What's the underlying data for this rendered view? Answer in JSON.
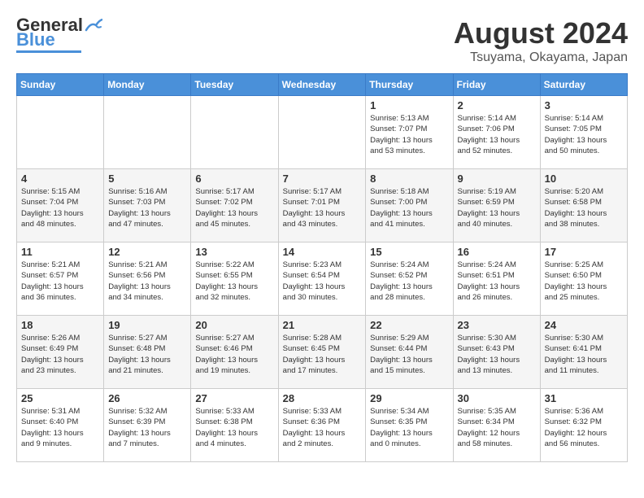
{
  "logo": {
    "text_general": "General",
    "text_blue": "Blue"
  },
  "header": {
    "month": "August 2024",
    "location": "Tsuyama, Okayama, Japan"
  },
  "weekdays": [
    "Sunday",
    "Monday",
    "Tuesday",
    "Wednesday",
    "Thursday",
    "Friday",
    "Saturday"
  ],
  "weeks": [
    [
      {
        "day": "",
        "info": ""
      },
      {
        "day": "",
        "info": ""
      },
      {
        "day": "",
        "info": ""
      },
      {
        "day": "",
        "info": ""
      },
      {
        "day": "1",
        "info": "Sunrise: 5:13 AM\nSunset: 7:07 PM\nDaylight: 13 hours\nand 53 minutes."
      },
      {
        "day": "2",
        "info": "Sunrise: 5:14 AM\nSunset: 7:06 PM\nDaylight: 13 hours\nand 52 minutes."
      },
      {
        "day": "3",
        "info": "Sunrise: 5:14 AM\nSunset: 7:05 PM\nDaylight: 13 hours\nand 50 minutes."
      }
    ],
    [
      {
        "day": "4",
        "info": "Sunrise: 5:15 AM\nSunset: 7:04 PM\nDaylight: 13 hours\nand 48 minutes."
      },
      {
        "day": "5",
        "info": "Sunrise: 5:16 AM\nSunset: 7:03 PM\nDaylight: 13 hours\nand 47 minutes."
      },
      {
        "day": "6",
        "info": "Sunrise: 5:17 AM\nSunset: 7:02 PM\nDaylight: 13 hours\nand 45 minutes."
      },
      {
        "day": "7",
        "info": "Sunrise: 5:17 AM\nSunset: 7:01 PM\nDaylight: 13 hours\nand 43 minutes."
      },
      {
        "day": "8",
        "info": "Sunrise: 5:18 AM\nSunset: 7:00 PM\nDaylight: 13 hours\nand 41 minutes."
      },
      {
        "day": "9",
        "info": "Sunrise: 5:19 AM\nSunset: 6:59 PM\nDaylight: 13 hours\nand 40 minutes."
      },
      {
        "day": "10",
        "info": "Sunrise: 5:20 AM\nSunset: 6:58 PM\nDaylight: 13 hours\nand 38 minutes."
      }
    ],
    [
      {
        "day": "11",
        "info": "Sunrise: 5:21 AM\nSunset: 6:57 PM\nDaylight: 13 hours\nand 36 minutes."
      },
      {
        "day": "12",
        "info": "Sunrise: 5:21 AM\nSunset: 6:56 PM\nDaylight: 13 hours\nand 34 minutes."
      },
      {
        "day": "13",
        "info": "Sunrise: 5:22 AM\nSunset: 6:55 PM\nDaylight: 13 hours\nand 32 minutes."
      },
      {
        "day": "14",
        "info": "Sunrise: 5:23 AM\nSunset: 6:54 PM\nDaylight: 13 hours\nand 30 minutes."
      },
      {
        "day": "15",
        "info": "Sunrise: 5:24 AM\nSunset: 6:52 PM\nDaylight: 13 hours\nand 28 minutes."
      },
      {
        "day": "16",
        "info": "Sunrise: 5:24 AM\nSunset: 6:51 PM\nDaylight: 13 hours\nand 26 minutes."
      },
      {
        "day": "17",
        "info": "Sunrise: 5:25 AM\nSunset: 6:50 PM\nDaylight: 13 hours\nand 25 minutes."
      }
    ],
    [
      {
        "day": "18",
        "info": "Sunrise: 5:26 AM\nSunset: 6:49 PM\nDaylight: 13 hours\nand 23 minutes."
      },
      {
        "day": "19",
        "info": "Sunrise: 5:27 AM\nSunset: 6:48 PM\nDaylight: 13 hours\nand 21 minutes."
      },
      {
        "day": "20",
        "info": "Sunrise: 5:27 AM\nSunset: 6:46 PM\nDaylight: 13 hours\nand 19 minutes."
      },
      {
        "day": "21",
        "info": "Sunrise: 5:28 AM\nSunset: 6:45 PM\nDaylight: 13 hours\nand 17 minutes."
      },
      {
        "day": "22",
        "info": "Sunrise: 5:29 AM\nSunset: 6:44 PM\nDaylight: 13 hours\nand 15 minutes."
      },
      {
        "day": "23",
        "info": "Sunrise: 5:30 AM\nSunset: 6:43 PM\nDaylight: 13 hours\nand 13 minutes."
      },
      {
        "day": "24",
        "info": "Sunrise: 5:30 AM\nSunset: 6:41 PM\nDaylight: 13 hours\nand 11 minutes."
      }
    ],
    [
      {
        "day": "25",
        "info": "Sunrise: 5:31 AM\nSunset: 6:40 PM\nDaylight: 13 hours\nand 9 minutes."
      },
      {
        "day": "26",
        "info": "Sunrise: 5:32 AM\nSunset: 6:39 PM\nDaylight: 13 hours\nand 7 minutes."
      },
      {
        "day": "27",
        "info": "Sunrise: 5:33 AM\nSunset: 6:38 PM\nDaylight: 13 hours\nand 4 minutes."
      },
      {
        "day": "28",
        "info": "Sunrise: 5:33 AM\nSunset: 6:36 PM\nDaylight: 13 hours\nand 2 minutes."
      },
      {
        "day": "29",
        "info": "Sunrise: 5:34 AM\nSunset: 6:35 PM\nDaylight: 13 hours\nand 0 minutes."
      },
      {
        "day": "30",
        "info": "Sunrise: 5:35 AM\nSunset: 6:34 PM\nDaylight: 12 hours\nand 58 minutes."
      },
      {
        "day": "31",
        "info": "Sunrise: 5:36 AM\nSunset: 6:32 PM\nDaylight: 12 hours\nand 56 minutes."
      }
    ]
  ]
}
